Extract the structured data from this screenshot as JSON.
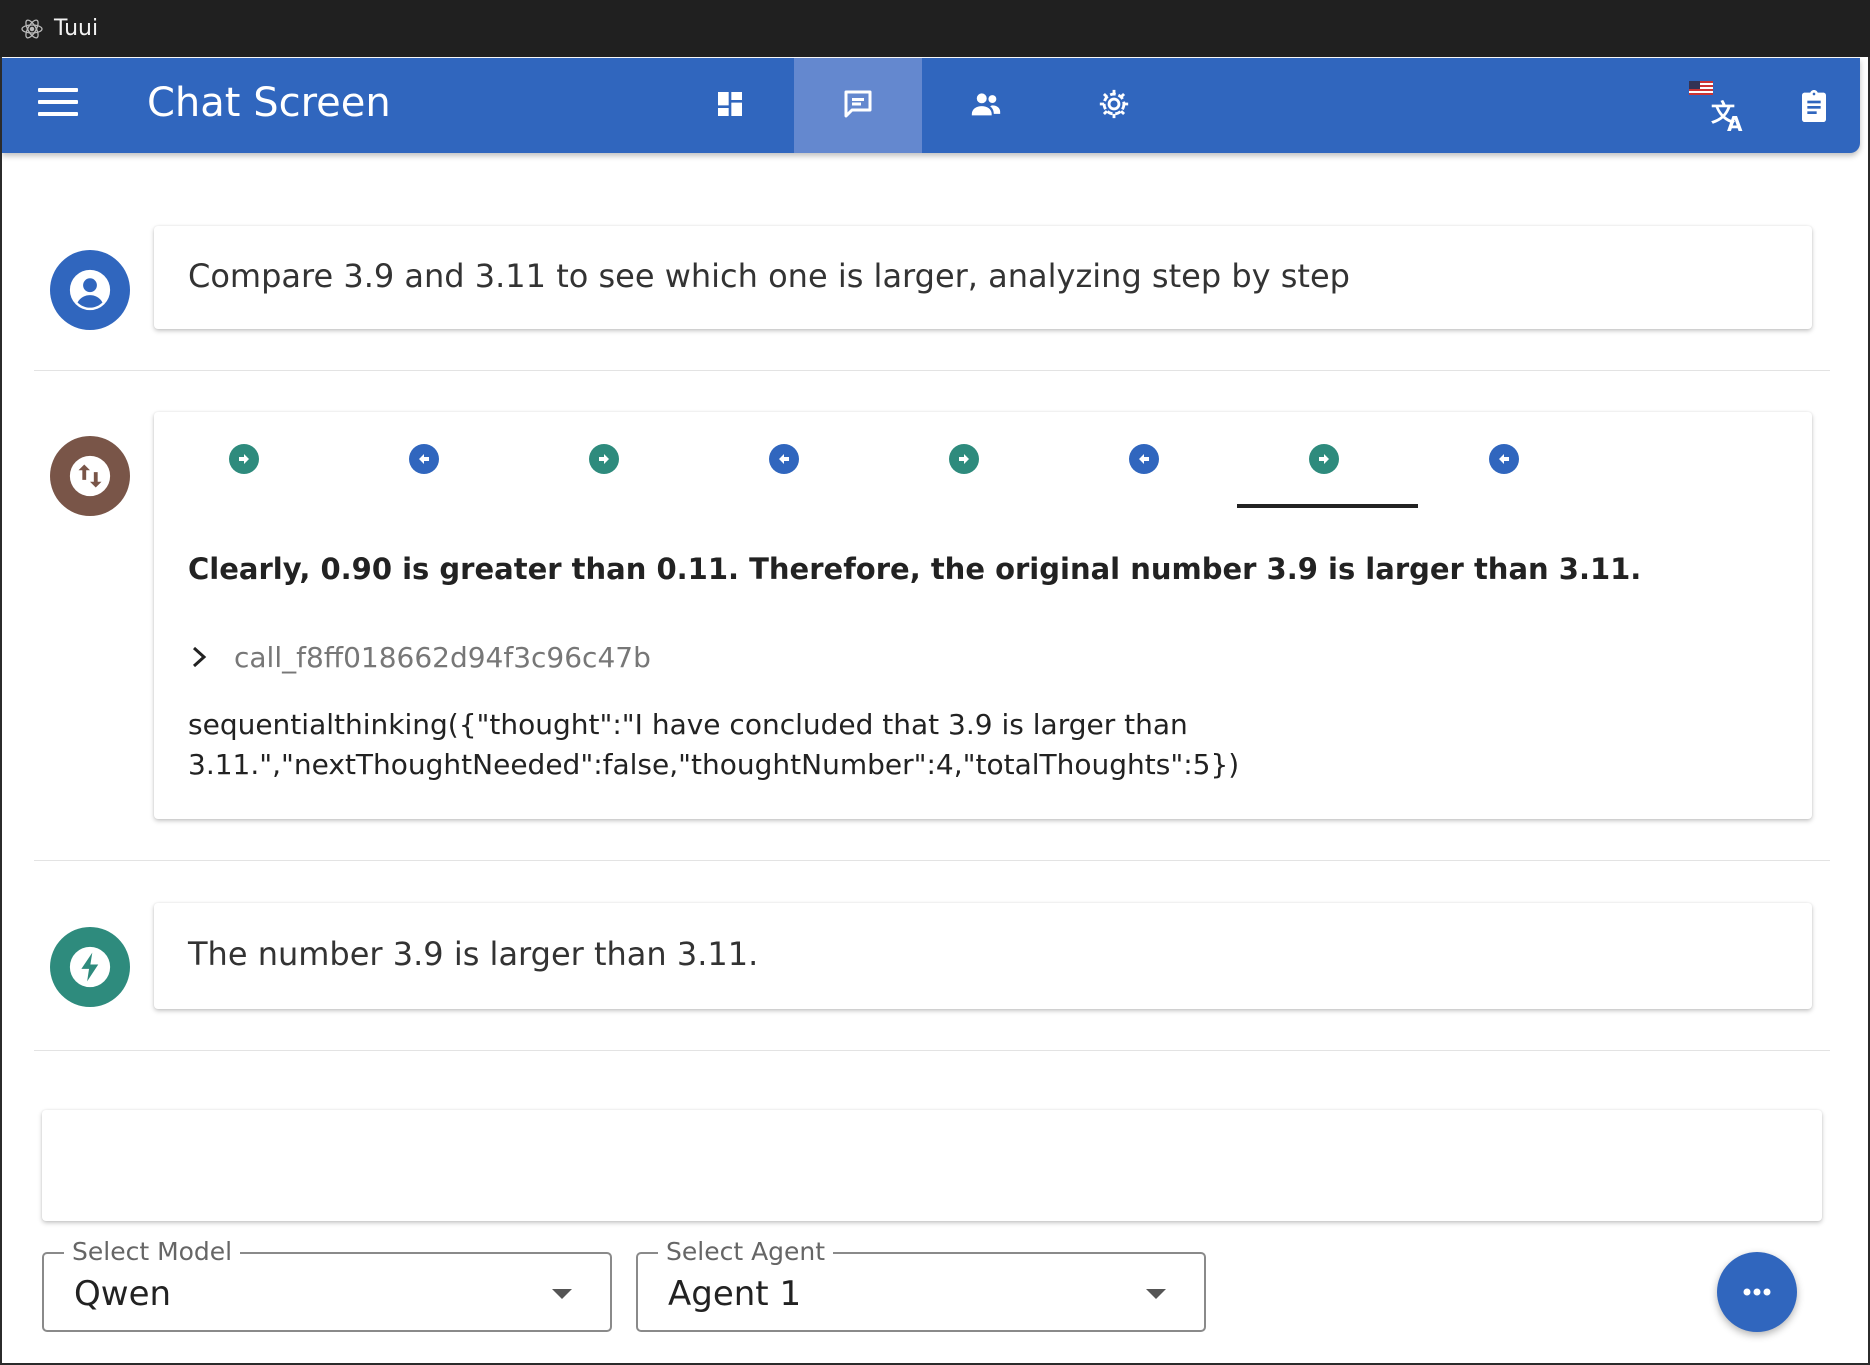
{
  "window": {
    "title": "Tuui",
    "app_icon": "atom-icon"
  },
  "appbar": {
    "page_title": "Chat Screen",
    "menu_icon": "hamburger-menu-icon",
    "nav_tabs": [
      {
        "icon": "dashboard-icon",
        "active": false
      },
      {
        "icon": "chat-icon",
        "active": true
      },
      {
        "icon": "users-icon",
        "active": false
      },
      {
        "icon": "settings-gear-icon",
        "active": false
      }
    ],
    "right_icons": [
      "language-translate-icon",
      "clipboard-icon"
    ],
    "colors": {
      "primary": "#3066be",
      "active_tab": "#6488cf"
    }
  },
  "messages": {
    "user": {
      "avatar_icon": "user-account-icon",
      "avatar_color": "#3066be",
      "text": "Compare 3.9 and 3.11 to see which one is larger, analyzing step by step"
    },
    "tool": {
      "avatar_icon": "swap-vertical-icon",
      "avatar_color": "#795548",
      "steps": [
        {
          "icon": "arrow-right-circle-icon",
          "color": "#2e8b7d"
        },
        {
          "icon": "arrow-left-circle-icon",
          "color": "#3066be"
        },
        {
          "icon": "arrow-right-circle-icon",
          "color": "#2e8b7d"
        },
        {
          "icon": "arrow-left-circle-icon",
          "color": "#3066be"
        },
        {
          "icon": "arrow-right-circle-icon",
          "color": "#2e8b7d"
        },
        {
          "icon": "arrow-left-circle-icon",
          "color": "#3066be"
        },
        {
          "icon": "arrow-right-circle-icon",
          "color": "#2e8b7d"
        },
        {
          "icon": "arrow-left-circle-icon",
          "color": "#3066be"
        }
      ],
      "active_step": 7,
      "bold_text": "Clearly, 0.90 is greater than 0.11. Therefore, the original number 3.9 is larger than 3.11.",
      "call_id": "call_f8ff018662d94f3c96c47b",
      "tool_call_line1": "sequentialthinking({\"thought\":\"I have concluded that 3.9 is larger than",
      "tool_call_line2": "3.11.\",\"nextThoughtNeeded\":false,\"thoughtNumber\":4,\"totalThoughts\":5})"
    },
    "assistant": {
      "avatar_icon": "lightning-bolt-icon",
      "avatar_color": "#2e8b7d",
      "text": "The number 3.9 is larger than 3.11."
    }
  },
  "input": {
    "value": ""
  },
  "selects": {
    "model": {
      "label": "Select Model",
      "value": "Qwen"
    },
    "agent": {
      "label": "Select Agent",
      "value": "Agent 1"
    }
  },
  "fab": {
    "icon": "more-dots-icon"
  }
}
